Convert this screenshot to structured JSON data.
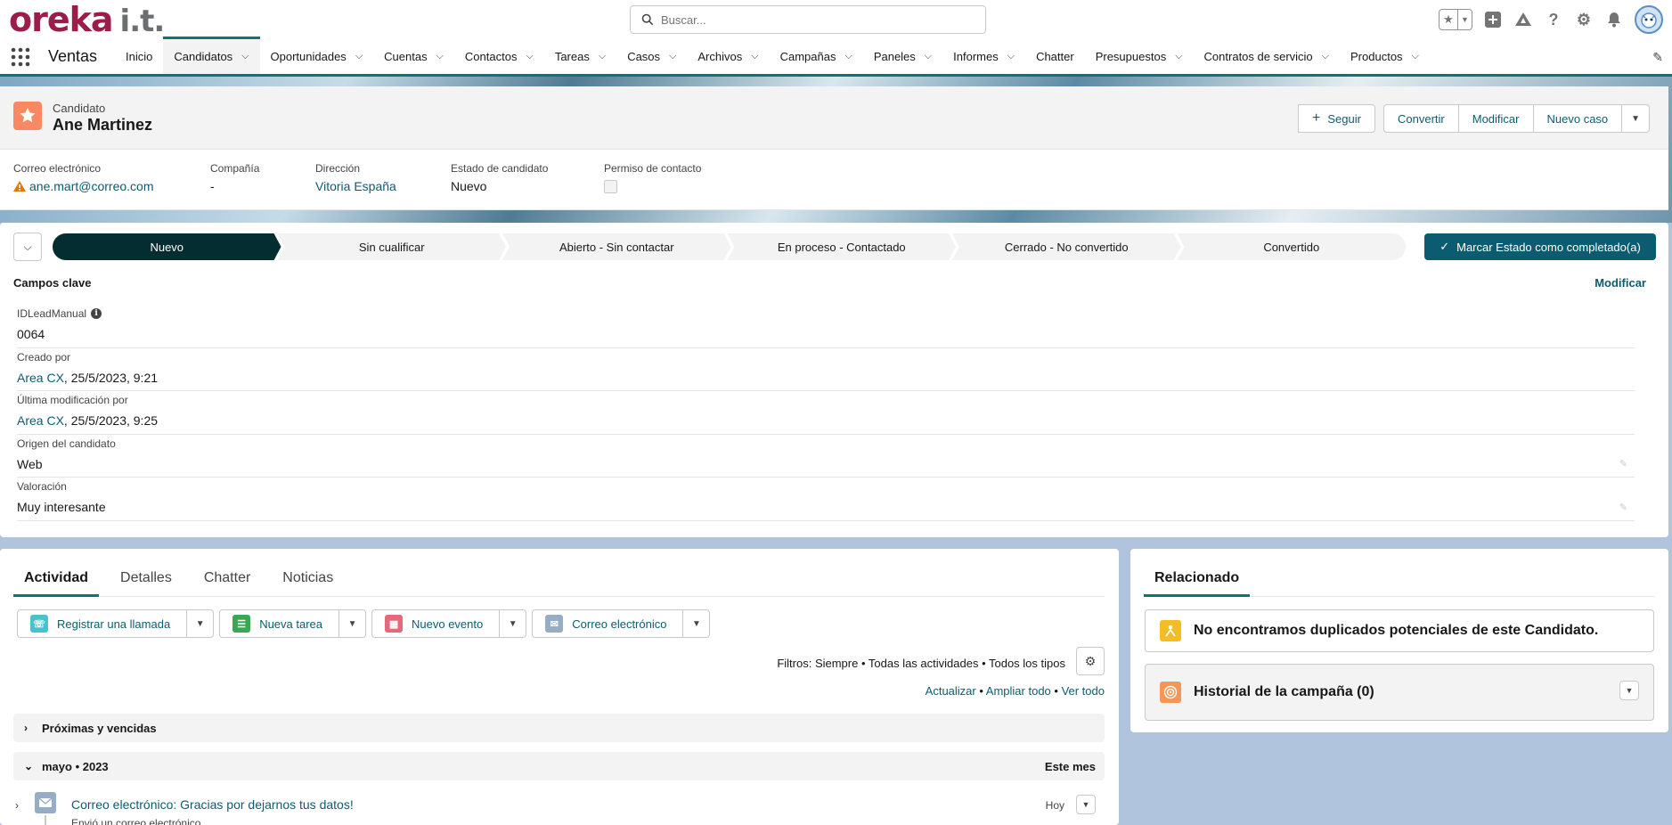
{
  "brand": {
    "logo_main": "oreka",
    "logo_sub": "i.t."
  },
  "search": {
    "placeholder": "Buscar..."
  },
  "nav": {
    "app_name": "Ventas",
    "items": [
      {
        "label": "Inicio",
        "has_menu": false,
        "active": false
      },
      {
        "label": "Candidatos",
        "has_menu": true,
        "active": true
      },
      {
        "label": "Oportunidades",
        "has_menu": true,
        "active": false
      },
      {
        "label": "Cuentas",
        "has_menu": true,
        "active": false
      },
      {
        "label": "Contactos",
        "has_menu": true,
        "active": false
      },
      {
        "label": "Tareas",
        "has_menu": true,
        "active": false
      },
      {
        "label": "Casos",
        "has_menu": true,
        "active": false
      },
      {
        "label": "Archivos",
        "has_menu": true,
        "active": false
      },
      {
        "label": "Campañas",
        "has_menu": true,
        "active": false
      },
      {
        "label": "Paneles",
        "has_menu": true,
        "active": false
      },
      {
        "label": "Informes",
        "has_menu": true,
        "active": false
      },
      {
        "label": "Chatter",
        "has_menu": false,
        "active": false
      },
      {
        "label": "Presupuestos",
        "has_menu": true,
        "active": false
      },
      {
        "label": "Contratos de servicio",
        "has_menu": true,
        "active": false
      },
      {
        "label": "Productos",
        "has_menu": true,
        "active": false
      }
    ]
  },
  "record": {
    "type_label": "Candidato",
    "name": "Ane Martinez",
    "actions": {
      "follow": "Seguir",
      "convert": "Convertir",
      "edit": "Modificar",
      "new_case": "Nuevo caso"
    },
    "highlights": {
      "email_label": "Correo electrónico",
      "email_value": "ane.mart@correo.com",
      "company_label": "Compañía",
      "company_value": "-",
      "address_label": "Dirección",
      "address_value": "Vitoria España",
      "status_label": "Estado de candidato",
      "status_value": "Nuevo",
      "permission_label": "Permiso de contacto"
    }
  },
  "path": {
    "stages": [
      "Nuevo",
      "Sin cualificar",
      "Abierto - Sin contactar",
      "En proceso - Contactado",
      "Cerrado - No convertido",
      "Convertido"
    ],
    "current_index": 0,
    "mark_button": "Marcar Estado como completado(a)"
  },
  "key_fields": {
    "title": "Campos clave",
    "edit": "Modificar",
    "rows": [
      {
        "label": "IDLeadManual",
        "value": "0064",
        "link": "",
        "info": true,
        "editable": false
      },
      {
        "label": "Creado por",
        "link": "Area CX",
        "value": ", 25/5/2023, 9:21",
        "info": false,
        "editable": false
      },
      {
        "label": "Última modificación por",
        "link": "Area CX",
        "value": ", 25/5/2023, 9:25",
        "info": false,
        "editable": false
      },
      {
        "label": "Origen del candidato",
        "value": "Web",
        "link": "",
        "info": false,
        "editable": true
      },
      {
        "label": "Valoración",
        "value": "Muy interesante",
        "link": "",
        "info": false,
        "editable": true
      }
    ]
  },
  "activity": {
    "tabs": [
      "Actividad",
      "Detalles",
      "Chatter",
      "Noticias"
    ],
    "active_tab": 0,
    "composer": [
      {
        "label": "Registrar una llamada",
        "color": "#48c3cc",
        "glyph": "☏"
      },
      {
        "label": "Nueva tarea",
        "color": "#3ba755",
        "glyph": "☰"
      },
      {
        "label": "Nuevo evento",
        "color": "#e5687d",
        "glyph": "▦"
      },
      {
        "label": "Correo electrónico",
        "color": "#95aec5",
        "glyph": "✉"
      }
    ],
    "filters_text": "Filtros: Siempre • Todas las actividades • Todos los tipos",
    "links": {
      "refresh": "Actualizar",
      "expand": "Ampliar todo",
      "view_all": "Ver todo",
      "sep": " • "
    },
    "upcoming": "Próximas y vencidas",
    "month_label": "mayo • 2023",
    "month_right": "Este mes",
    "item": {
      "title": "Correo electrónico: Gracias por dejarnos tus datos!",
      "subtitle": "Envió un correo electrónico",
      "date": "Hoy"
    }
  },
  "related": {
    "tab": "Relacionado",
    "duplicates": "No encontramos duplicados potenciales de este Candidato.",
    "campaign_history": "Historial de la campaña (0)"
  },
  "colors": {
    "brand": "#9b1d4a",
    "accent": "#0b7477",
    "path_current": "#032d30",
    "button": "#0b5c70",
    "lead_icon": "#f88962"
  }
}
